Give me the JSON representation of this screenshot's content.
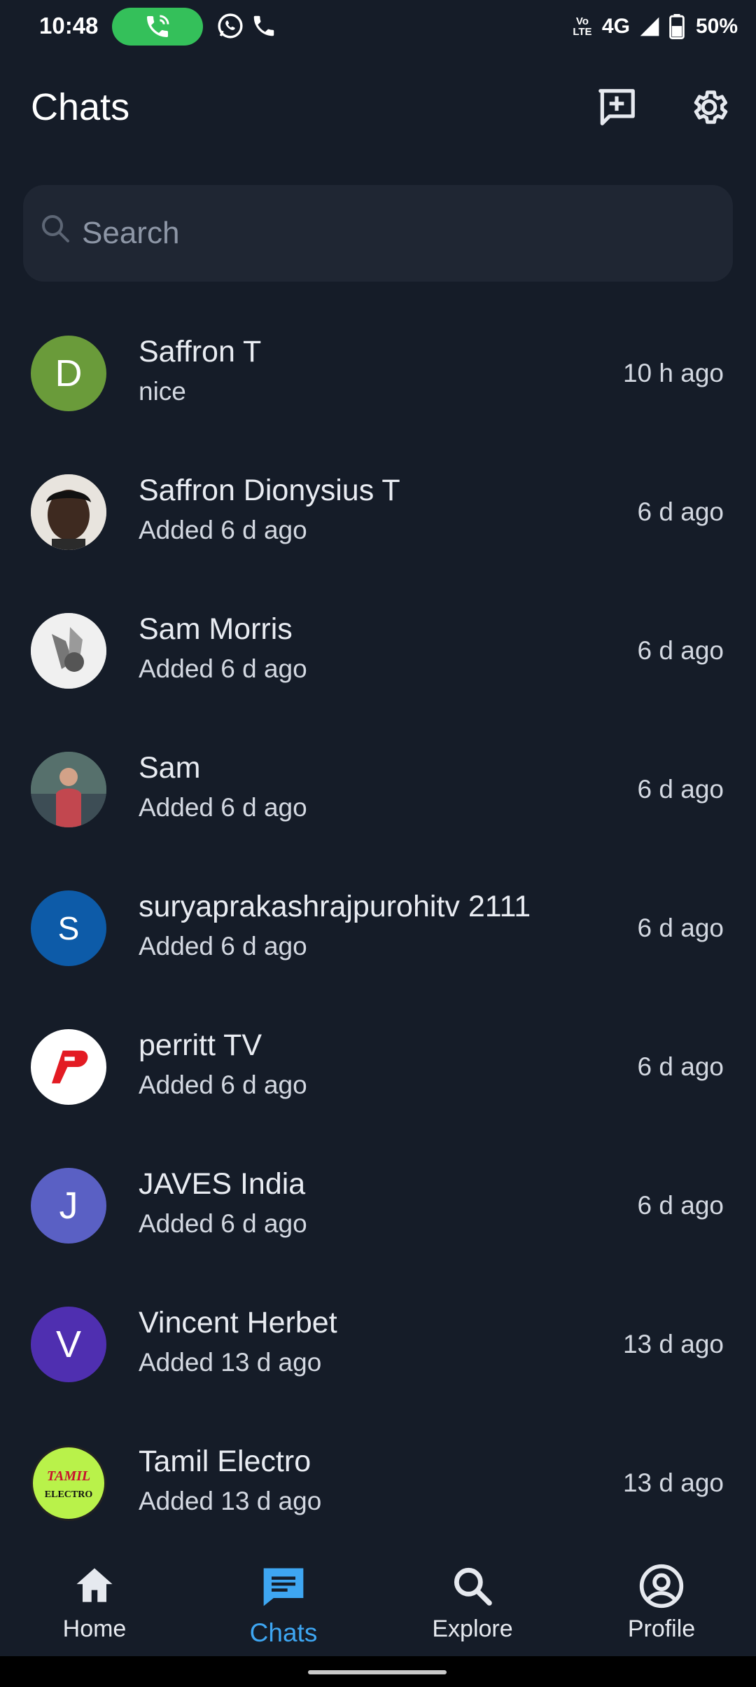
{
  "status_bar": {
    "time": "10:48",
    "volte": "Vo LTE",
    "network": "4G",
    "battery": "50%"
  },
  "header": {
    "title": "Chats"
  },
  "search": {
    "placeholder": "Search"
  },
  "chats": [
    {
      "name": "Saffron T",
      "subtitle": "nice",
      "time": "10 h ago",
      "avatar_letter": "D",
      "avatar_color": "#6a9b3a"
    },
    {
      "name": "Saffron Dionysius T",
      "subtitle": "Added 6 d ago",
      "time": "6 d ago",
      "avatar_letter": "",
      "avatar_color": "#5a4a3e"
    },
    {
      "name": "Sam Morris",
      "subtitle": "Added 6 d ago",
      "time": "6 d ago",
      "avatar_letter": "",
      "avatar_color": "#e8e8e8"
    },
    {
      "name": "Sam",
      "subtitle": "Added 6 d ago",
      "time": "6 d ago",
      "avatar_letter": "",
      "avatar_color": "#4d6a63"
    },
    {
      "name": "suryaprakashrajpurohitv 2111",
      "subtitle": "Added 6 d ago",
      "time": "6 d ago",
      "avatar_letter": "S",
      "avatar_color": "#0d5ba8"
    },
    {
      "name": "perritt TV",
      "subtitle": "Added 6 d ago",
      "time": "6 d ago",
      "avatar_letter": "",
      "avatar_color": "#ffffff"
    },
    {
      "name": "JAVES India",
      "subtitle": "Added 6 d ago",
      "time": "6 d ago",
      "avatar_letter": "J",
      "avatar_color": "#5a60c4"
    },
    {
      "name": "Vincent Herbet",
      "subtitle": "Added 13 d ago",
      "time": "13 d ago",
      "avatar_letter": "V",
      "avatar_color": "#4f2fb0"
    },
    {
      "name": "Tamil Electro",
      "subtitle": "Added 13 d ago",
      "time": "13 d ago",
      "avatar_letter": "",
      "avatar_color": "#b9f24a",
      "logo_text_top": "TAMIL",
      "logo_text_bottom": "ELECTRO"
    }
  ],
  "bottom_nav": {
    "items": [
      {
        "label": "Home",
        "icon": "home-icon"
      },
      {
        "label": "Chats",
        "icon": "chat-icon",
        "active": true
      },
      {
        "label": "Explore",
        "icon": "search-icon"
      },
      {
        "label": "Profile",
        "icon": "profile-icon"
      }
    ]
  },
  "colors": {
    "background": "#151c28",
    "accent": "#3ea6f2",
    "call_pill": "#34c05a"
  }
}
